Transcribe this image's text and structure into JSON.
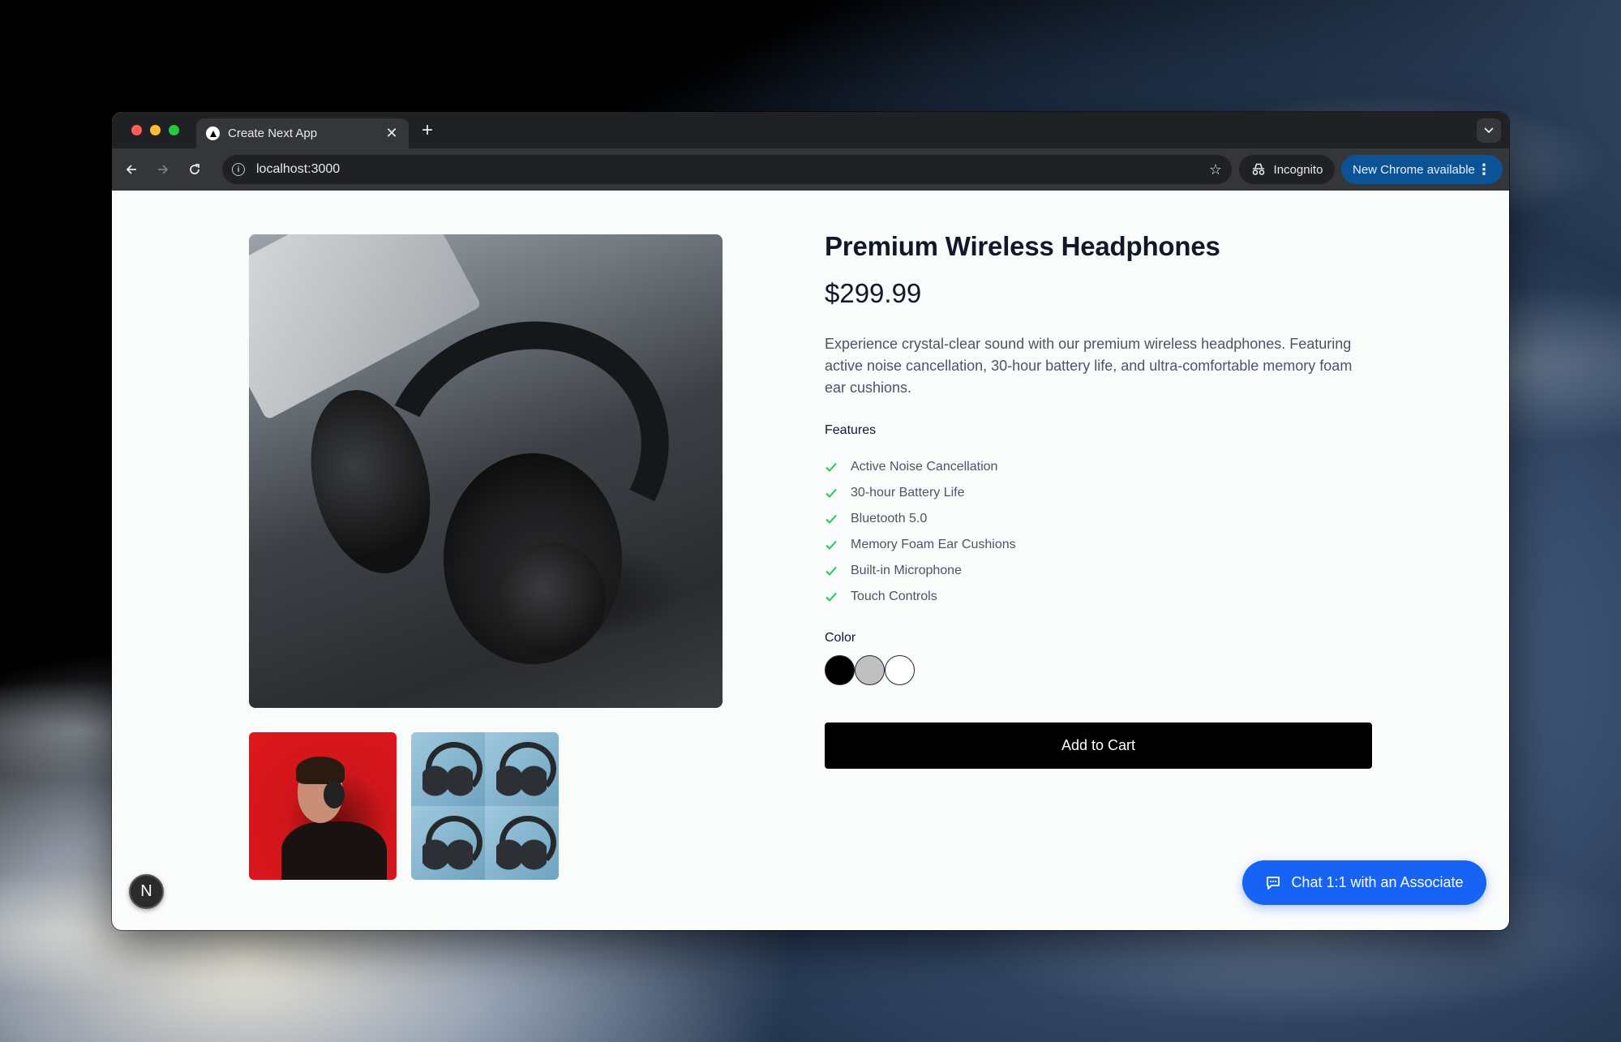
{
  "browser": {
    "tab_title": "Create Next App",
    "url": "localhost:3000",
    "incognito_label": "Incognito",
    "update_label": "New Chrome available"
  },
  "product": {
    "title": "Premium Wireless Headphones",
    "price": "$299.99",
    "description": "Experience crystal-clear sound with our premium wireless headphones. Featuring active noise cancellation, 30-hour battery life, and ultra-comfortable memory foam ear cushions.",
    "features_heading": "Features",
    "features": [
      "Active Noise Cancellation",
      "30-hour Battery Life",
      "Bluetooth 5.0",
      "Memory Foam Ear Cushions",
      "Built-in Microphone",
      "Touch Controls"
    ],
    "color_heading": "Color",
    "colors": [
      "#000000",
      "#c0c0c0",
      "#ffffff"
    ],
    "add_to_cart_label": "Add to Cart"
  },
  "chat": {
    "label": "Chat 1:1 with an Associate"
  },
  "dev_badge": {
    "letter": "N"
  },
  "theme": {
    "accent_blue": "#1663f5",
    "check_green": "#22c55e",
    "update_pill_blue": "#0b5394"
  }
}
